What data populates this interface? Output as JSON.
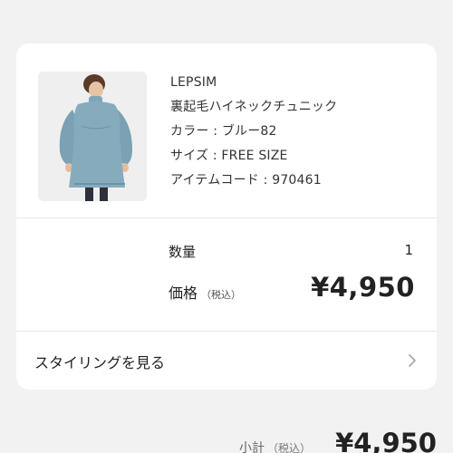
{
  "product": {
    "brand": "LEPSIM",
    "name": "裏起毛ハイネックチュニック",
    "color": "カラー : ブルー82",
    "size": "サイズ : FREE SIZE",
    "item_code": "アイテムコード : 970461"
  },
  "order": {
    "quantity_label": "数量",
    "quantity_value": "1",
    "price_label": "価格",
    "price_tax_note": "（税込）",
    "price_value": "¥4,950"
  },
  "styling": {
    "link_label": "スタイリングを見る"
  },
  "summary": {
    "subtotal_label": "小計",
    "subtotal_tax_note": "（税込）",
    "subtotal_value": "¥4,950"
  },
  "colors": {
    "background": "#f2f2f2",
    "card": "#ffffff",
    "text": "#222222",
    "product_blue": "#7fa6b8"
  }
}
